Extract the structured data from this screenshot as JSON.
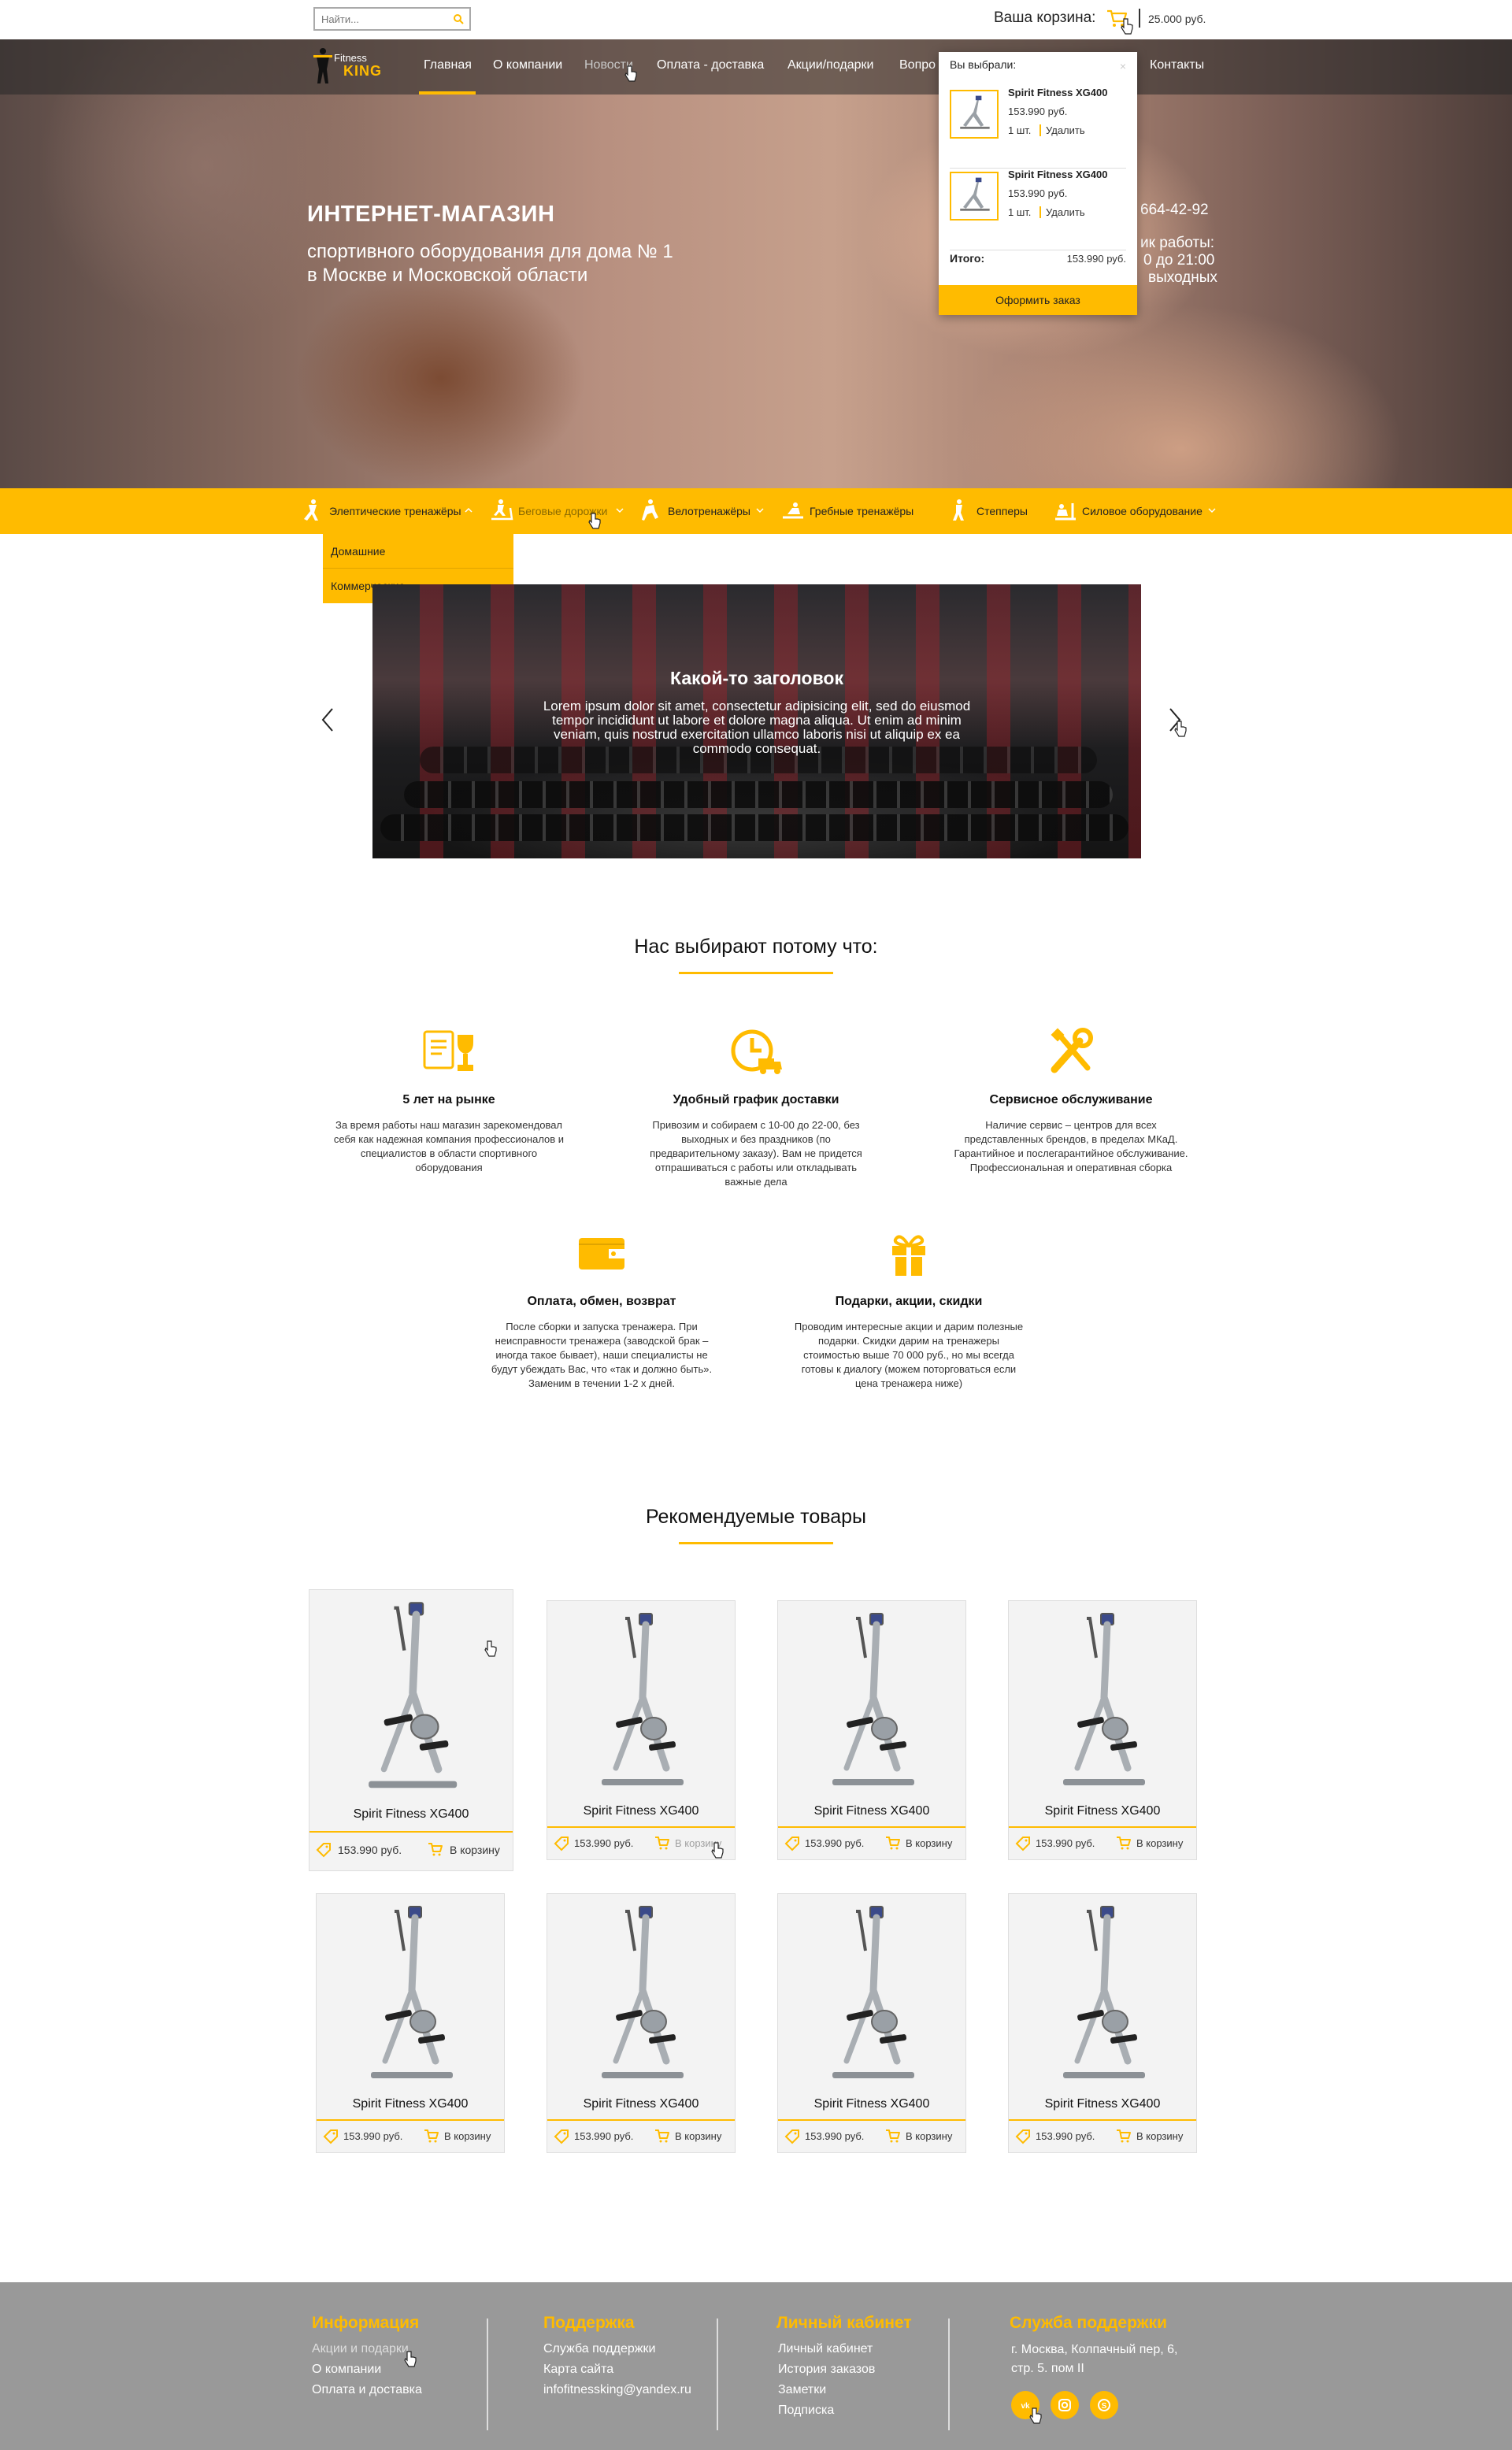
{
  "search": {
    "placeholder": "Найти..."
  },
  "cart": {
    "label": "Ваша корзина:",
    "total": "25.000 руб."
  },
  "brand": {
    "line1": "Fitness",
    "line2": "KING"
  },
  "nav": {
    "items": [
      {
        "label": "Главная"
      },
      {
        "label": "О компании"
      },
      {
        "label": "Новости"
      },
      {
        "label": "Оплата - доставка"
      },
      {
        "label": "Акции/подарки"
      },
      {
        "label": "Вопро"
      },
      {
        "label": "Контакты"
      }
    ]
  },
  "hero": {
    "title": "ИНТЕРНЕТ-МАГАЗИН",
    "subtitle_line1": "спортивного оборудования для дома № 1",
    "subtitle_line2": "в Москве и Московской области",
    "phone": "664-42-92",
    "hours_line1": "ик работы:",
    "hours_line2": "0 до 21:00",
    "hours_line3": "выходных"
  },
  "cart_dropdown": {
    "title": "Вы выбрали:",
    "close": "×",
    "items": [
      {
        "name": "Spirit Fitness XG400",
        "price": "153.990 руб.",
        "qty": "1 шт.",
        "remove": "Удалить"
      },
      {
        "name": "Spirit Fitness XG400",
        "price": "153.990 руб.",
        "qty": "1 шт.",
        "remove": "Удалить"
      }
    ],
    "total_label": "Итого:",
    "total_value": "153.990 руб.",
    "order_button": "Оформить заказ"
  },
  "categories": {
    "items": [
      {
        "label": "Элептические тренажёры",
        "icon": "elliptical-icon"
      },
      {
        "label": "Беговые дорожки",
        "icon": "treadmill-icon"
      },
      {
        "label": "Велотренажёры",
        "icon": "bike-icon"
      },
      {
        "label": "Гребные тренажёры",
        "icon": "rowing-icon"
      },
      {
        "label": "Степперы",
        "icon": "stepper-icon"
      },
      {
        "label": "Силовое оборудование",
        "icon": "strength-icon"
      }
    ],
    "submenu": [
      {
        "label": "Домашние"
      },
      {
        "label": "Коммерческие"
      }
    ]
  },
  "slider": {
    "title": "Какой-то заголовок",
    "text": "Lorem ipsum dolor sit amet, consectetur adipisicing elit, sed do eiusmod tempor incididunt ut labore et dolore magna aliqua. Ut enim ad minim veniam, quis nostrud exercitation ullamco laboris nisi ut aliquip ex ea commodo consequat."
  },
  "why": {
    "title": "Нас выбирают потому что:",
    "features": [
      {
        "title": "5 лет на рынке",
        "text": "За время работы наш магазин зарекомендовал себя как надежная компания профессионалов и специалистов в области спортивного оборудования",
        "icon": "certificate-trophy-icon"
      },
      {
        "title": "Удобный график доставки",
        "text": "Привозим и собираем с 10-00 до 22-00, без выходных и без праздников (по предварительному заказу). Вам не придется отпрашиваться с работы или откладывать важные дела",
        "icon": "clock-truck-icon"
      },
      {
        "title": "Сервисное обслуживание",
        "text": "Наличие сервис – центров для всех представленных брендов, в пределах МКаД. Гарантийное и послегарантийное обслуживание. Профессиональная и оперативная сборка",
        "icon": "tools-icon"
      },
      {
        "title": "Оплата, обмен, возврат",
        "text": "После сборки и запуска тренажера. При неисправности тренажера (заводской брак – иногда такое бывает), наши специалисты не будут убеждать Вас, что «так и должно быть». Заменим в течении 1-2 х дней.",
        "icon": "wallet-icon"
      },
      {
        "title": "Подарки, акции, скидки",
        "text": "Проводим интересные акции и дарим полезные подарки. Скидки дарим на тренажеры стоимостью выше 70 000 руб., но мы всегда готовы к диалогу (можем поторговаться если цена тренажера ниже)",
        "icon": "gift-icon"
      }
    ]
  },
  "recommended": {
    "title": "Рекомендуемые товары",
    "products": [
      {
        "name": "Spirit Fitness XG400",
        "price": "153.990 руб.",
        "cart": "В корзину"
      },
      {
        "name": "Spirit Fitness XG400",
        "price": "153.990 руб.",
        "cart": "В корзину"
      },
      {
        "name": "Spirit Fitness XG400",
        "price": "153.990 руб.",
        "cart": "В корзину"
      },
      {
        "name": "Spirit Fitness XG400",
        "price": "153.990 руб.",
        "cart": "В корзину"
      },
      {
        "name": "Spirit Fitness XG400",
        "price": "153.990 руб.",
        "cart": "В корзину"
      },
      {
        "name": "Spirit Fitness XG400",
        "price": "153.990 руб.",
        "cart": "В корзину"
      },
      {
        "name": "Spirit Fitness XG400",
        "price": "153.990 руб.",
        "cart": "В корзину"
      },
      {
        "name": "Spirit Fitness XG400",
        "price": "153.990 руб.",
        "cart": "В корзину"
      }
    ]
  },
  "footer": {
    "columns": [
      {
        "title": "Информация",
        "links": [
          "Акции и подарки",
          "О компании",
          "Оплата и доставка"
        ]
      },
      {
        "title": "Поддержка",
        "links": [
          "Служба поддержки",
          "Карта сайта",
          "infofitnessking@yandex.ru"
        ]
      },
      {
        "title": "Личный кабинет",
        "links": [
          "Личный кабинет",
          "История заказов",
          "Заметки",
          "Подписка"
        ]
      },
      {
        "title": "Служба поддержки",
        "address": "г. Москва, Колпачный пер, 6, стр. 5. пом II"
      }
    ],
    "social": [
      "vk-icon",
      "instagram-icon",
      "skype-icon"
    ]
  },
  "colors": {
    "accent": "#ffbb00",
    "footer_bg": "#999999",
    "text": "#222222"
  }
}
